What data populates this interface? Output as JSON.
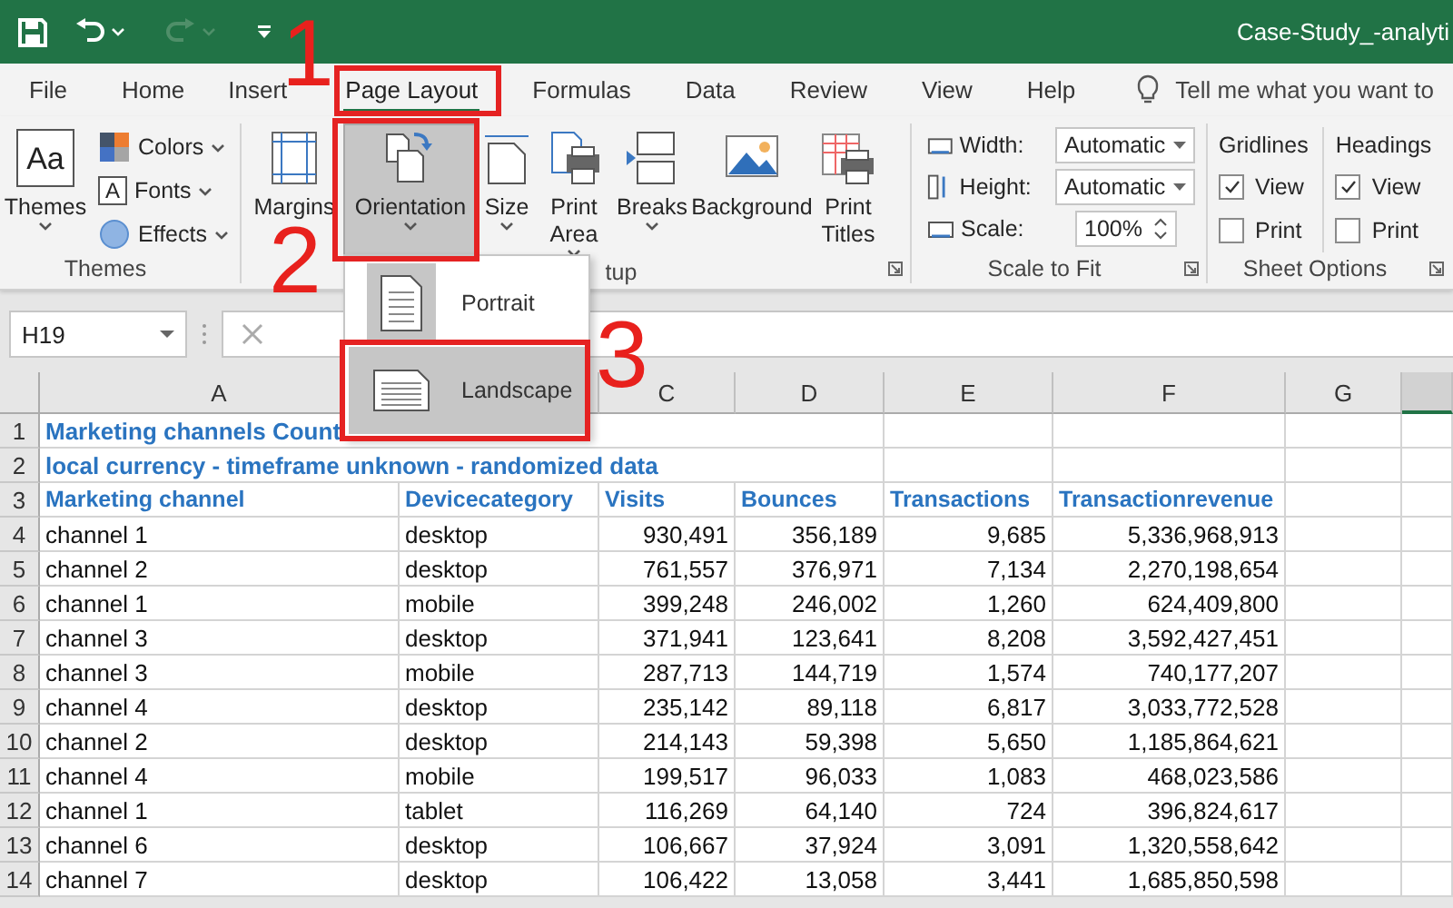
{
  "title_bar": {
    "title": "Case-Study_-analyti"
  },
  "quick_access": [
    {
      "kind": "save",
      "disabled": false
    },
    {
      "kind": "undo",
      "disabled": false
    },
    {
      "kind": "redo",
      "disabled": true
    },
    {
      "kind": "customize",
      "disabled": false
    }
  ],
  "tabs": [
    {
      "label": "File",
      "selected": false
    },
    {
      "label": "Home",
      "selected": false
    },
    {
      "label": "Insert",
      "selected": false
    },
    {
      "label": "Page Layout",
      "selected": true
    },
    {
      "label": "Formulas",
      "selected": false
    },
    {
      "label": "Data",
      "selected": false
    },
    {
      "label": "Review",
      "selected": false
    },
    {
      "label": "View",
      "selected": false
    },
    {
      "label": "Help",
      "selected": false
    }
  ],
  "tell_me": {
    "placeholder": "Tell me what you want to"
  },
  "themes_group": {
    "label": "Themes",
    "themes_button": {
      "label": "Themes",
      "icon_text": "Aa"
    },
    "items": [
      {
        "kind": "colors",
        "label": "Colors"
      },
      {
        "kind": "fonts",
        "label": "Fonts",
        "icon_text": "A"
      },
      {
        "kind": "effects",
        "label": "Effects"
      }
    ]
  },
  "page_setup_group": {
    "label": "tup",
    "buttons": [
      {
        "kind": "margins",
        "label": "Margins",
        "pressed": false,
        "dropdown": false
      },
      {
        "kind": "orientation",
        "label": "Orientation",
        "pressed": true,
        "dropdown": true
      },
      {
        "kind": "size",
        "label": "Size",
        "pressed": false,
        "dropdown": true
      },
      {
        "kind": "print_area",
        "label": "Print Area",
        "pressed": false,
        "dropdown": true
      },
      {
        "kind": "breaks",
        "label": "Breaks",
        "pressed": false,
        "dropdown": true
      },
      {
        "kind": "background",
        "label": "Background",
        "pressed": false,
        "dropdown": false
      },
      {
        "kind": "print_titles",
        "label": "Print Titles",
        "pressed": false,
        "dropdown": false
      }
    ]
  },
  "scale_group": {
    "label": "Scale to Fit",
    "fields": [
      {
        "kind": "combo",
        "label": "Width:",
        "value": "Automatic"
      },
      {
        "kind": "combo",
        "label": "Height:",
        "value": "Automatic"
      },
      {
        "kind": "spin",
        "label": "Scale:",
        "value": "100%"
      }
    ]
  },
  "sheet_options_group": {
    "label": "Sheet Options",
    "columns": [
      {
        "title": "Gridlines",
        "options": [
          {
            "label": "View",
            "checked": true
          },
          {
            "label": "Print",
            "checked": false
          }
        ]
      },
      {
        "title": "Headings",
        "options": [
          {
            "label": "View",
            "checked": true
          },
          {
            "label": "Print",
            "checked": false
          }
        ]
      }
    ]
  },
  "formula_bar": {
    "name_box": "H19"
  },
  "orientation_menu": {
    "items": [
      {
        "label": "Portrait",
        "current": true,
        "highlighted": false
      },
      {
        "label": "Landscape",
        "current": false,
        "highlighted": true
      }
    ]
  },
  "sheet": {
    "column_headers": [
      {
        "label": "A",
        "selected": false
      },
      {
        "selected": false
      },
      {
        "label": "C",
        "selected": false
      },
      {
        "label": "D",
        "selected": false
      },
      {
        "label": "E",
        "selected": false
      },
      {
        "label": "F",
        "selected": false
      },
      {
        "label": "G",
        "selected": false
      },
      {
        "selected": true
      }
    ],
    "rows": [
      {
        "number": "1",
        "kind": "title",
        "text": "Marketing channels Count"
      },
      {
        "number": "2",
        "kind": "title",
        "text": "local currency - timeframe unknown - randomized data"
      },
      {
        "number": "3",
        "kind": "header",
        "cells": [
          "Marketing channel",
          "Devicecategory",
          "Visits",
          "Bounces",
          "Transactions",
          "Transactionrevenue"
        ]
      },
      {
        "number": "4",
        "kind": "data",
        "cells": [
          "channel 1",
          "desktop",
          "930,491",
          "356,189",
          "9,685",
          "5,336,968,913"
        ]
      },
      {
        "number": "5",
        "kind": "data",
        "cells": [
          "channel 2",
          "desktop",
          "761,557",
          "376,971",
          "7,134",
          "2,270,198,654"
        ]
      },
      {
        "number": "6",
        "kind": "data",
        "cells": [
          "channel 1",
          "mobile",
          "399,248",
          "246,002",
          "1,260",
          "624,409,800"
        ]
      },
      {
        "number": "7",
        "kind": "data",
        "cells": [
          "channel 3",
          "desktop",
          "371,941",
          "123,641",
          "8,208",
          "3,592,427,451"
        ]
      },
      {
        "number": "8",
        "kind": "data",
        "cells": [
          "channel 3",
          "mobile",
          "287,713",
          "144,719",
          "1,574",
          "740,177,207"
        ]
      },
      {
        "number": "9",
        "kind": "data",
        "cells": [
          "channel 4",
          "desktop",
          "235,142",
          "89,118",
          "6,817",
          "3,033,772,528"
        ]
      },
      {
        "number": "10",
        "kind": "data",
        "cells": [
          "channel 2",
          "desktop",
          "214,143",
          "59,398",
          "5,650",
          "1,185,864,621"
        ]
      },
      {
        "number": "11",
        "kind": "data",
        "cells": [
          "channel 4",
          "mobile",
          "199,517",
          "96,033",
          "1,083",
          "468,023,586"
        ]
      },
      {
        "number": "12",
        "kind": "data",
        "cells": [
          "channel 1",
          "tablet",
          "116,269",
          "64,140",
          "724",
          "396,824,617"
        ]
      },
      {
        "number": "13",
        "kind": "data",
        "cells": [
          "channel 6",
          "desktop",
          "106,667",
          "37,924",
          "3,091",
          "1,320,558,642"
        ]
      },
      {
        "number": "14",
        "kind": "data",
        "cells": [
          "channel 7",
          "desktop",
          "106,422",
          "13,058",
          "3,441",
          "1,685,850,598"
        ]
      }
    ]
  },
  "annotations": [
    {
      "label": "1"
    },
    {
      "label": "2"
    },
    {
      "label": "3"
    }
  ]
}
